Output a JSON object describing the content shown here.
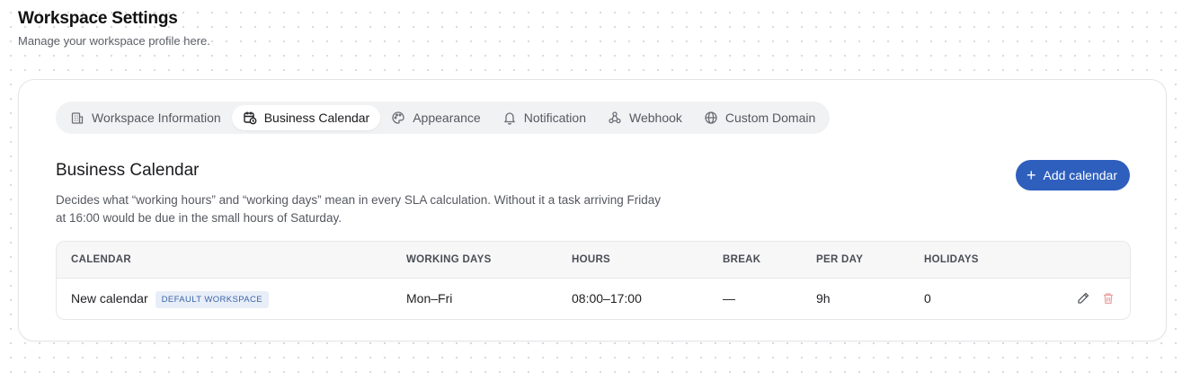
{
  "header": {
    "title": "Workspace Settings",
    "subtitle": "Manage your workspace profile here."
  },
  "tabs": [
    {
      "label": "Workspace Information",
      "icon": "building-icon",
      "active": false
    },
    {
      "label": "Business Calendar",
      "icon": "calendar-clock-icon",
      "active": true
    },
    {
      "label": "Appearance",
      "icon": "palette-icon",
      "active": false
    },
    {
      "label": "Notification",
      "icon": "bell-icon",
      "active": false
    },
    {
      "label": "Webhook",
      "icon": "webhook-icon",
      "active": false
    },
    {
      "label": "Custom Domain",
      "icon": "globe-icon",
      "active": false
    }
  ],
  "section": {
    "title": "Business Calendar",
    "description": "Decides what “working hours” and “working days” mean in every SLA calculation. Without it a task arriving Friday at 16:00 would be due in the small hours of Saturday.",
    "add_button": "Add calendar"
  },
  "table": {
    "columns": [
      "CALENDAR",
      "WORKING DAYS",
      "HOURS",
      "BREAK",
      "PER DAY",
      "HOLIDAYS"
    ],
    "rows": [
      {
        "calendar": "New calendar",
        "badge": "DEFAULT WORKSPACE",
        "working_days": "Mon–Fri",
        "hours": "08:00–17:00",
        "break": "—",
        "per_day": "9h",
        "holidays": "0"
      }
    ]
  },
  "colors": {
    "accent": "#2e5fbd",
    "badge_bg": "#e8eef8",
    "badge_text": "#3c64a8",
    "delete_icon": "#e9a3a3"
  }
}
